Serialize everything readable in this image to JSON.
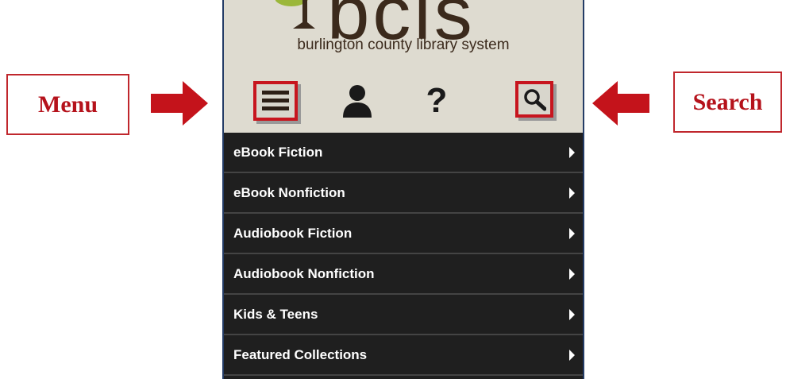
{
  "callouts": {
    "menu": "Menu",
    "search": "Search"
  },
  "logo": {
    "word": "bcls",
    "tagline": "burlington county library system"
  },
  "toolbar": {
    "help_glyph": "?",
    "icons": [
      "menu-icon",
      "user-icon",
      "help-icon",
      "search-icon"
    ]
  },
  "menu": {
    "items": [
      {
        "label": "eBook Fiction"
      },
      {
        "label": "eBook Nonfiction"
      },
      {
        "label": "Audiobook Fiction"
      },
      {
        "label": "Audiobook Nonfiction"
      },
      {
        "label": "Kids & Teens"
      },
      {
        "label": "Featured Collections"
      }
    ]
  },
  "colors": {
    "callout_red": "#b5121b",
    "highlight_red": "#c7151e",
    "header_bg": "#dedbd0",
    "menu_bg": "#1f1f1f"
  }
}
